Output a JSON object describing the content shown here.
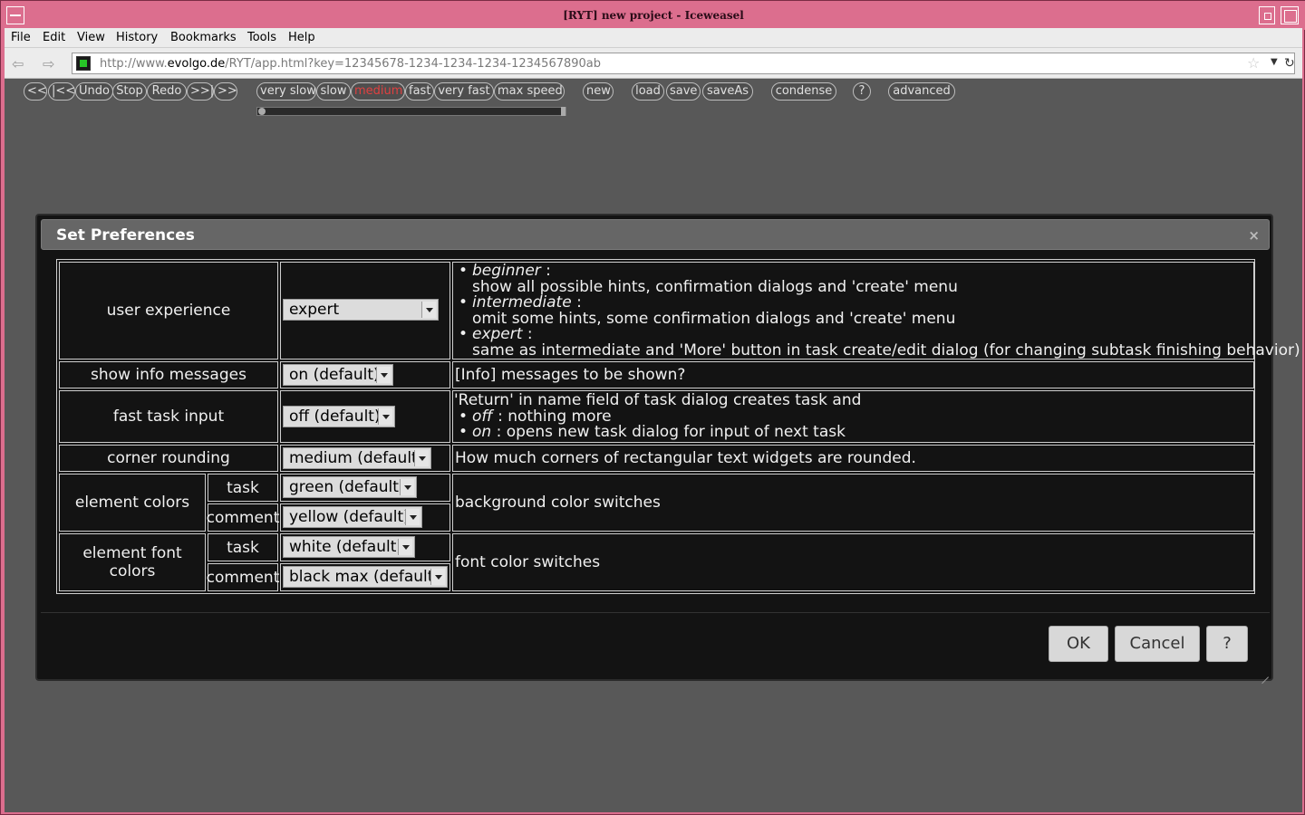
{
  "window": {
    "title": "[RYT] new project - Iceweasel"
  },
  "menubar": {
    "items": [
      "File",
      "Edit",
      "View",
      "History",
      "Bookmarks",
      "Tools",
      "Help"
    ]
  },
  "navbar": {
    "url_prefix": "http://www.",
    "url_host": "evolgo.de",
    "url_rest": "/RYT/app.html?key=12345678-1234-1234-1234-1234567890ab"
  },
  "toolbar": {
    "nav": [
      "<<",
      "|<<",
      "Undo",
      "Stop",
      "Redo",
      ">>|",
      ">>"
    ],
    "speeds": [
      "very slow",
      "slow",
      "medium",
      "fast",
      "very fast",
      "max speed"
    ],
    "active_speed": "medium",
    "new": "new",
    "load": "load",
    "save": "save",
    "saveAs": "saveAs",
    "condense": "condense",
    "help": "?",
    "advanced": "advanced"
  },
  "dialog": {
    "title": "Set Preferences",
    "close": "×",
    "rows": {
      "user_experience": {
        "label": "user experience",
        "value": "expert",
        "desc": {
          "beginner": "beginner",
          "beginner_text": "show all possible hints, confirmation dialogs and 'create' menu",
          "intermediate": "intermediate",
          "intermediate_text": "omit some hints, some confirmation dialogs and 'create' menu",
          "expert": "expert",
          "expert_text": "same as intermediate and 'More' button in task create/edit dialog (for changing subtask finishing behavior)"
        }
      },
      "show_info": {
        "label": "show info messages",
        "value": "on (default)",
        "desc": "[Info] messages to be shown?"
      },
      "fast_task": {
        "label": "fast task input",
        "value": "off (default)",
        "desc_line1": "'Return' in name field of task dialog creates task and",
        "off": "off",
        "off_text": "nothing more",
        "on": "on",
        "on_text": "opens new task dialog for input of next task"
      },
      "corner_rounding": {
        "label": "corner rounding",
        "value": "medium (default)",
        "desc": "How much corners of rectangular text widgets are rounded."
      },
      "element_colors": {
        "label": "element colors",
        "task_label": "task",
        "task_value": "green (default)",
        "comment_label": "comment",
        "comment_value": "yellow (default)",
        "desc": "background color switches"
      },
      "element_font_colors": {
        "label": "element font colors",
        "task_label": "task",
        "task_value": "white (default)",
        "comment_label": "comment",
        "comment_value": "black max (default)",
        "desc": "font color switches"
      }
    },
    "buttons": {
      "ok": "OK",
      "cancel": "Cancel",
      "help": "?"
    }
  }
}
